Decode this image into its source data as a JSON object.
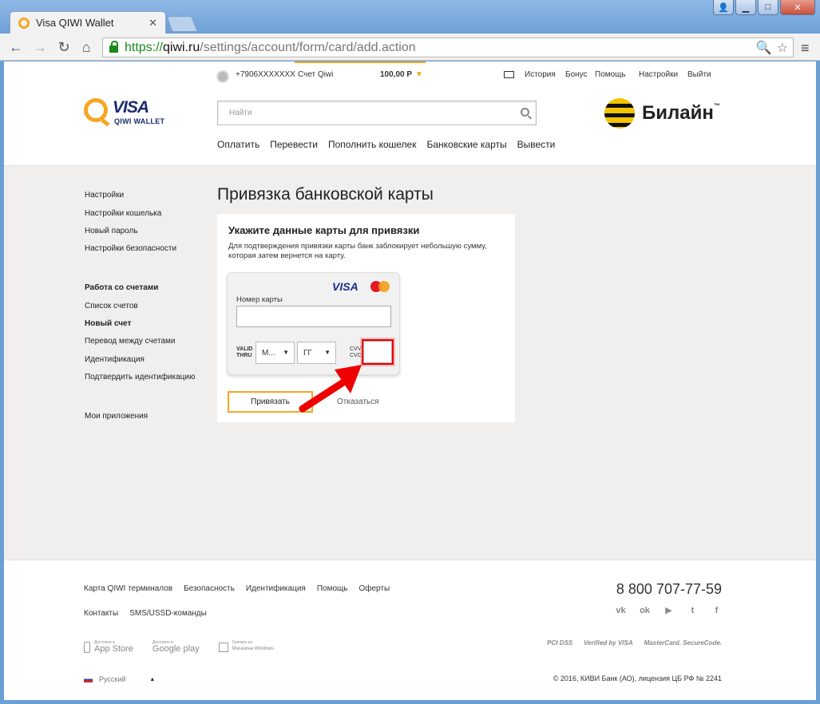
{
  "browser": {
    "tab_title": "Visa QIWI Wallet",
    "tab_close": "✕",
    "url_scheme": "https://",
    "url_host": "qiwi.ru",
    "url_path": "/settings/account/form/card/add.action",
    "win_min": "▁",
    "win_max": "□",
    "win_close": "✕"
  },
  "header": {
    "phone": "+7906XXXXXXX",
    "account_label": "Счет Qiwi",
    "balance": "100,00 Р",
    "balance_caret": "▼",
    "links": [
      "История",
      "Бонус",
      "Помощь",
      "Настройки",
      "Выйти"
    ],
    "logo_visa": "VISA",
    "logo_wallet": "QIWI WALLET",
    "search_placeholder": "Найти",
    "partner_name": "Билайн",
    "partner_tm": "™",
    "nav": [
      "Оплатить",
      "Перевести",
      "Пополнить кошелек",
      "Банковские карты",
      "Вывести"
    ]
  },
  "sidebar": {
    "group1": [
      "Настройки",
      "Настройки кошелька",
      "Новый пароль",
      "Настройки безопасности"
    ],
    "group2_title": "Работа со счетами",
    "group2": [
      "Список счетов",
      "Новый счет",
      "Перевод между счетами",
      "Идентификация",
      "Подтвердить идентификацию"
    ],
    "apps": "Мои приложения"
  },
  "main": {
    "title": "Привязка банковской карты",
    "form_heading": "Укажите данные карты для привязки",
    "form_note": "Для подтверждения привязки карты банк заблокирует небольшую сумму, которая затем вернется на карту.",
    "card": {
      "brand_visa": "VISA",
      "brand_mc": "MasterCard",
      "number_label": "Номер карты",
      "number_value": "",
      "valid_label_1": "VALID",
      "valid_label_2": "THRU",
      "month_value": "М...",
      "year_value": "ГГ",
      "cvv_label_1": "CVV",
      "cvv_label_2": "CVC",
      "cvv_value": ""
    },
    "submit_label": "Привязать",
    "cancel_label": "Отказаться"
  },
  "footer": {
    "links_row1": [
      "Карта QIWI терминалов",
      "Безопасность",
      "Идентификация",
      "Помощь",
      "Оферты"
    ],
    "links_row2": [
      "Контакты",
      "SMS/USSD-команды"
    ],
    "phone": "8 800 707-77-59",
    "stores": [
      {
        "small": "Доступно в",
        "name": "App Store"
      },
      {
        "small": "Доступно в",
        "name": "Google play"
      },
      {
        "small": "Скачать из",
        "name": "Магазина Windows"
      }
    ],
    "payment_badges": [
      "PCI DSS",
      "Verified by VISA",
      "MasterCard. SecureCode."
    ],
    "language": "Русский",
    "language_caret": "▲",
    "copyright": "© 2016, КИВИ Банк (АО), лицензия ЦБ РФ № 2241"
  },
  "colors": {
    "accent_orange": "#f5a623",
    "highlight_red": "#e00000",
    "visa_blue": "#1a2b6d"
  }
}
